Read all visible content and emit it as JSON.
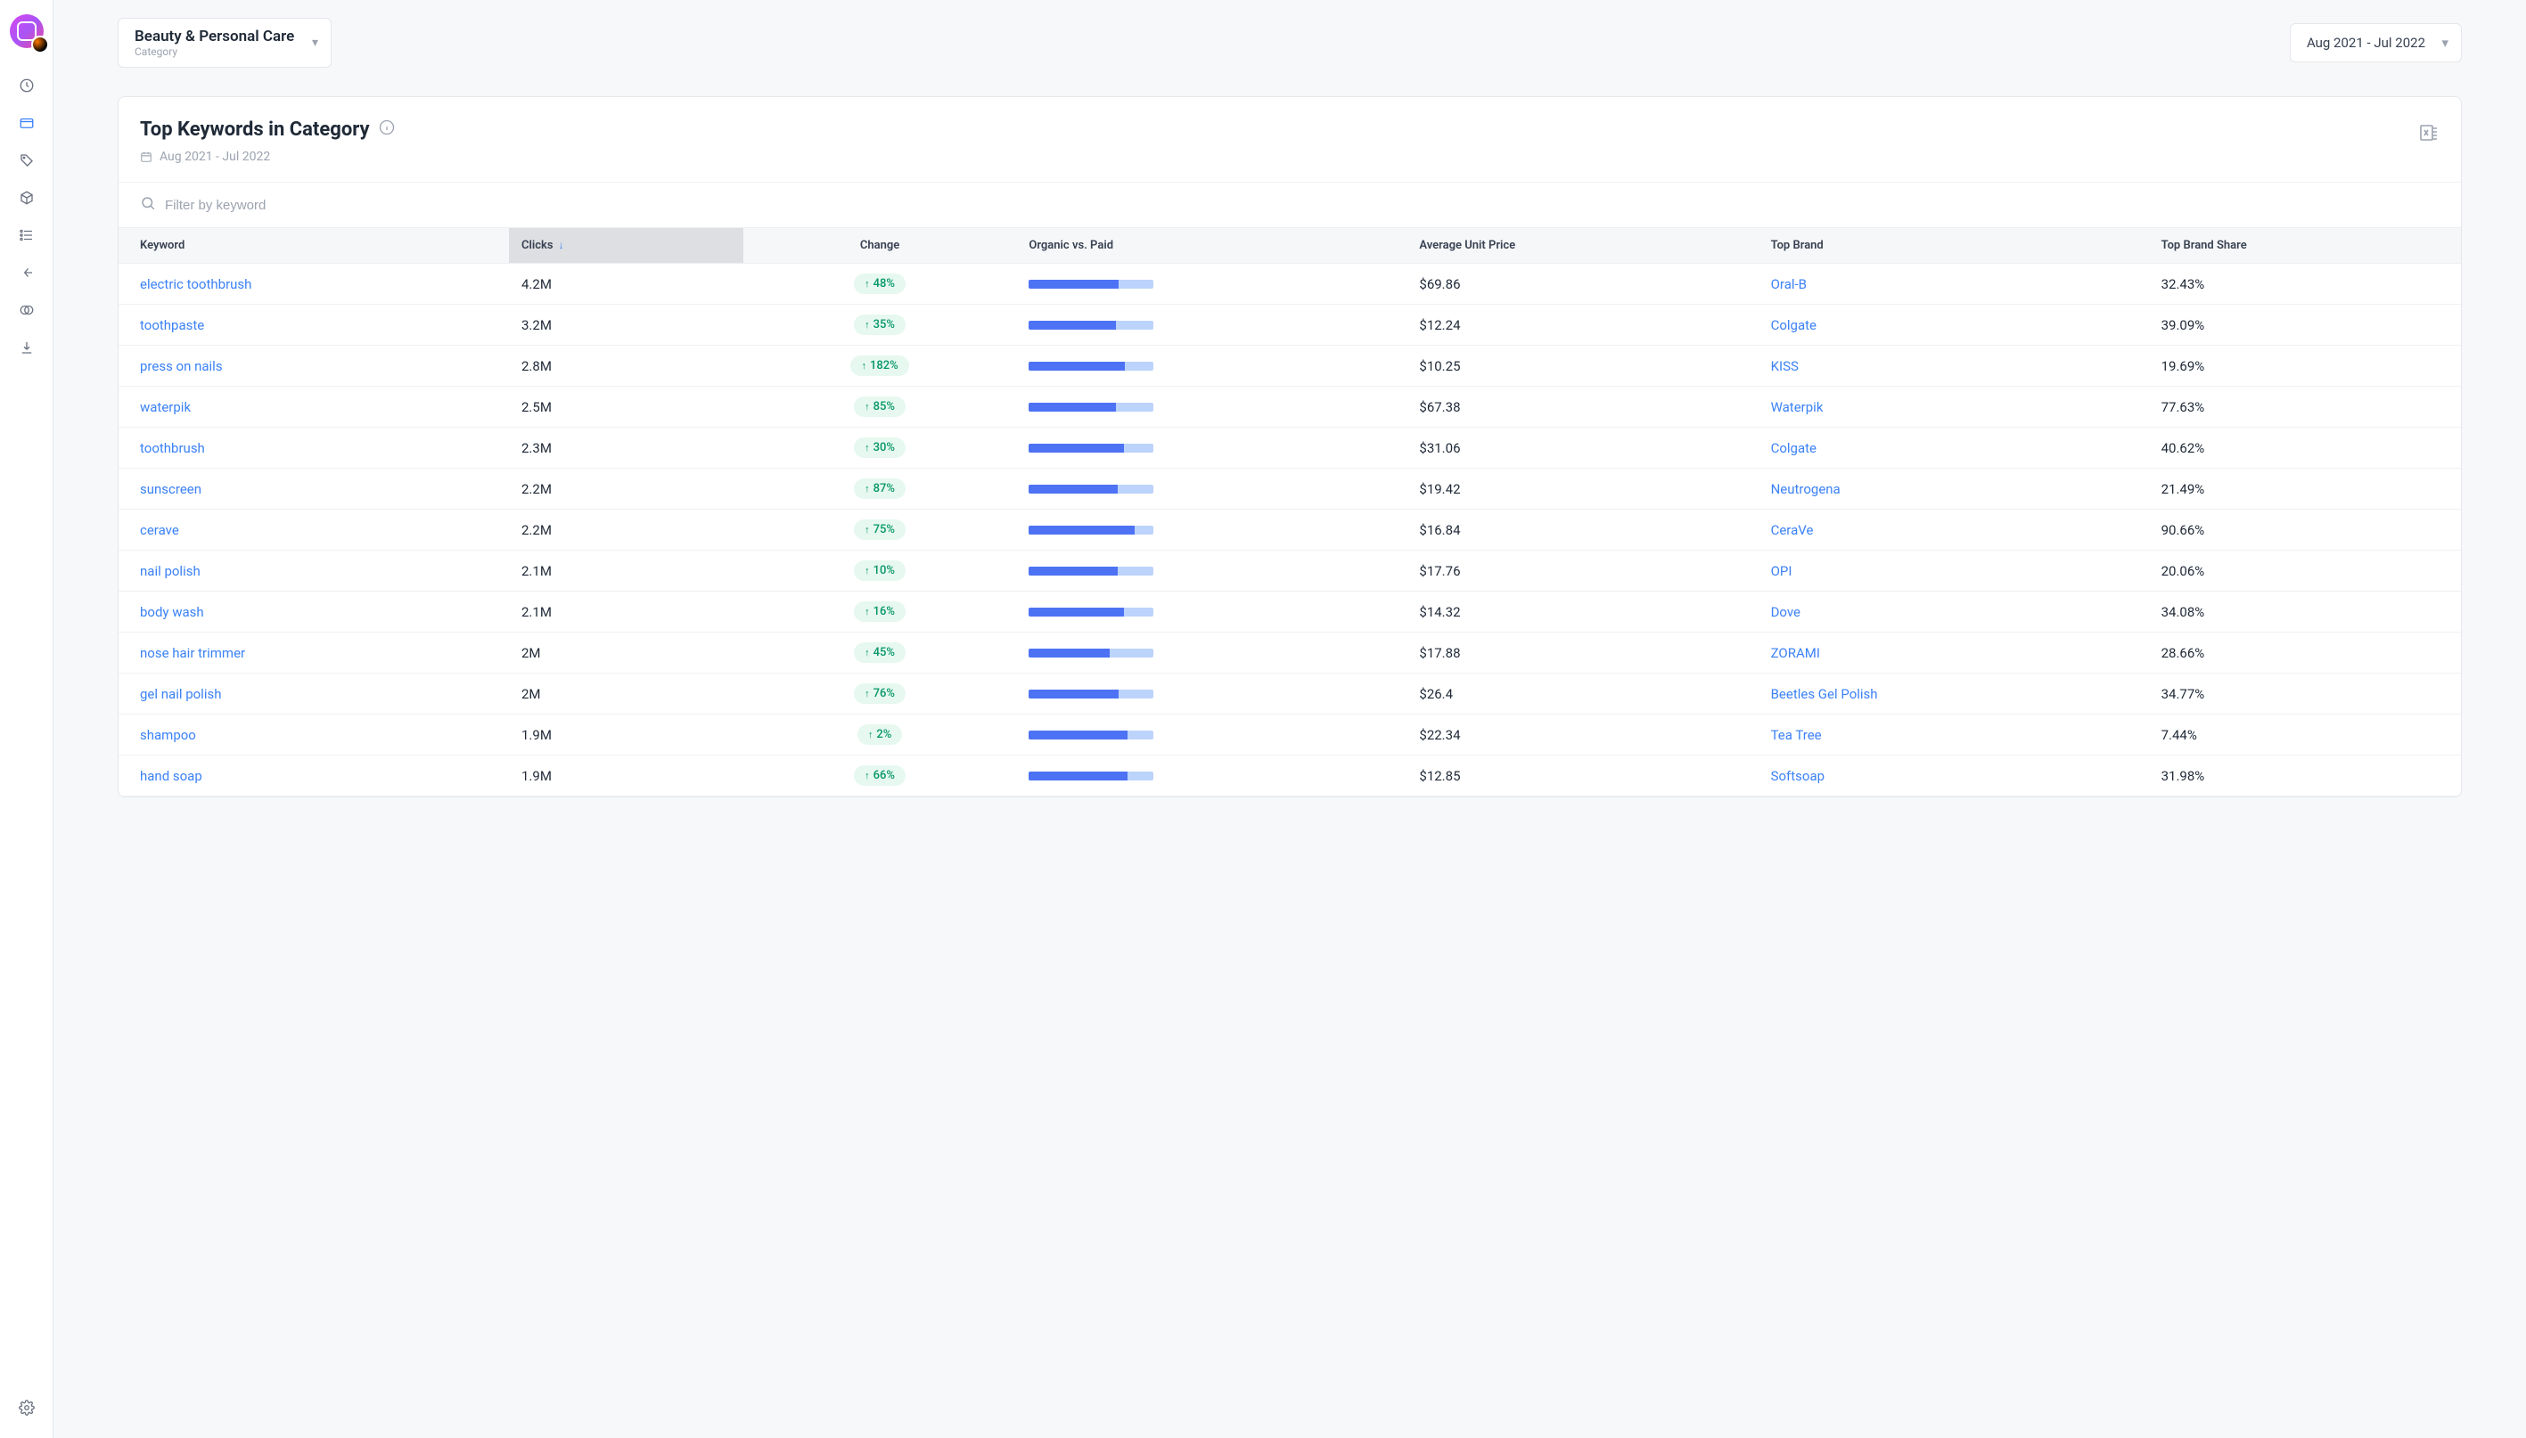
{
  "selector": {
    "title": "Beauty & Personal Care",
    "subtitle": "Category"
  },
  "date_range": "Aug 2021 - Jul 2022",
  "card": {
    "title": "Top Keywords in Category",
    "date": "Aug 2021 - Jul 2022"
  },
  "filter": {
    "placeholder": "Filter by keyword"
  },
  "headers": {
    "keyword": "Keyword",
    "clicks": "Clicks",
    "change": "Change",
    "ovp": "Organic vs. Paid",
    "price": "Average Unit Price",
    "brand": "Top Brand",
    "share": "Top Brand Share"
  },
  "rows": [
    {
      "keyword": "electric toothbrush",
      "clicks": "4.2M",
      "change": "48%",
      "ovp": 72,
      "price": "$69.86",
      "brand": "Oral-B",
      "share": "32.43%"
    },
    {
      "keyword": "toothpaste",
      "clicks": "3.2M",
      "change": "35%",
      "ovp": 70,
      "price": "$12.24",
      "brand": "Colgate",
      "share": "39.09%"
    },
    {
      "keyword": "press on nails",
      "clicks": "2.8M",
      "change": "182%",
      "ovp": 77,
      "price": "$10.25",
      "brand": "KISS",
      "share": "19.69%"
    },
    {
      "keyword": "waterpik",
      "clicks": "2.5M",
      "change": "85%",
      "ovp": 70,
      "price": "$67.38",
      "brand": "Waterpik",
      "share": "77.63%"
    },
    {
      "keyword": "toothbrush",
      "clicks": "2.3M",
      "change": "30%",
      "ovp": 76,
      "price": "$31.06",
      "brand": "Colgate",
      "share": "40.62%"
    },
    {
      "keyword": "sunscreen",
      "clicks": "2.2M",
      "change": "87%",
      "ovp": 71,
      "price": "$19.42",
      "brand": "Neutrogena",
      "share": "21.49%"
    },
    {
      "keyword": "cerave",
      "clicks": "2.2M",
      "change": "75%",
      "ovp": 85,
      "price": "$16.84",
      "brand": "CeraVe",
      "share": "90.66%"
    },
    {
      "keyword": "nail polish",
      "clicks": "2.1M",
      "change": "10%",
      "ovp": 71,
      "price": "$17.76",
      "brand": "OPI",
      "share": "20.06%"
    },
    {
      "keyword": "body wash",
      "clicks": "2.1M",
      "change": "16%",
      "ovp": 76,
      "price": "$14.32",
      "brand": "Dove",
      "share": "34.08%"
    },
    {
      "keyword": "nose hair trimmer",
      "clicks": "2M",
      "change": "45%",
      "ovp": 65,
      "price": "$17.88",
      "brand": "ZORAMI",
      "share": "28.66%"
    },
    {
      "keyword": "gel nail polish",
      "clicks": "2M",
      "change": "76%",
      "ovp": 72,
      "price": "$26.4",
      "brand": "Beetles Gel Polish",
      "share": "34.77%"
    },
    {
      "keyword": "shampoo",
      "clicks": "1.9M",
      "change": "2%",
      "ovp": 79,
      "price": "$22.34",
      "brand": "Tea Tree",
      "share": "7.44%"
    },
    {
      "keyword": "hand soap",
      "clicks": "1.9M",
      "change": "66%",
      "ovp": 79,
      "price": "$12.85",
      "brand": "Softsoap",
      "share": "31.98%"
    }
  ]
}
